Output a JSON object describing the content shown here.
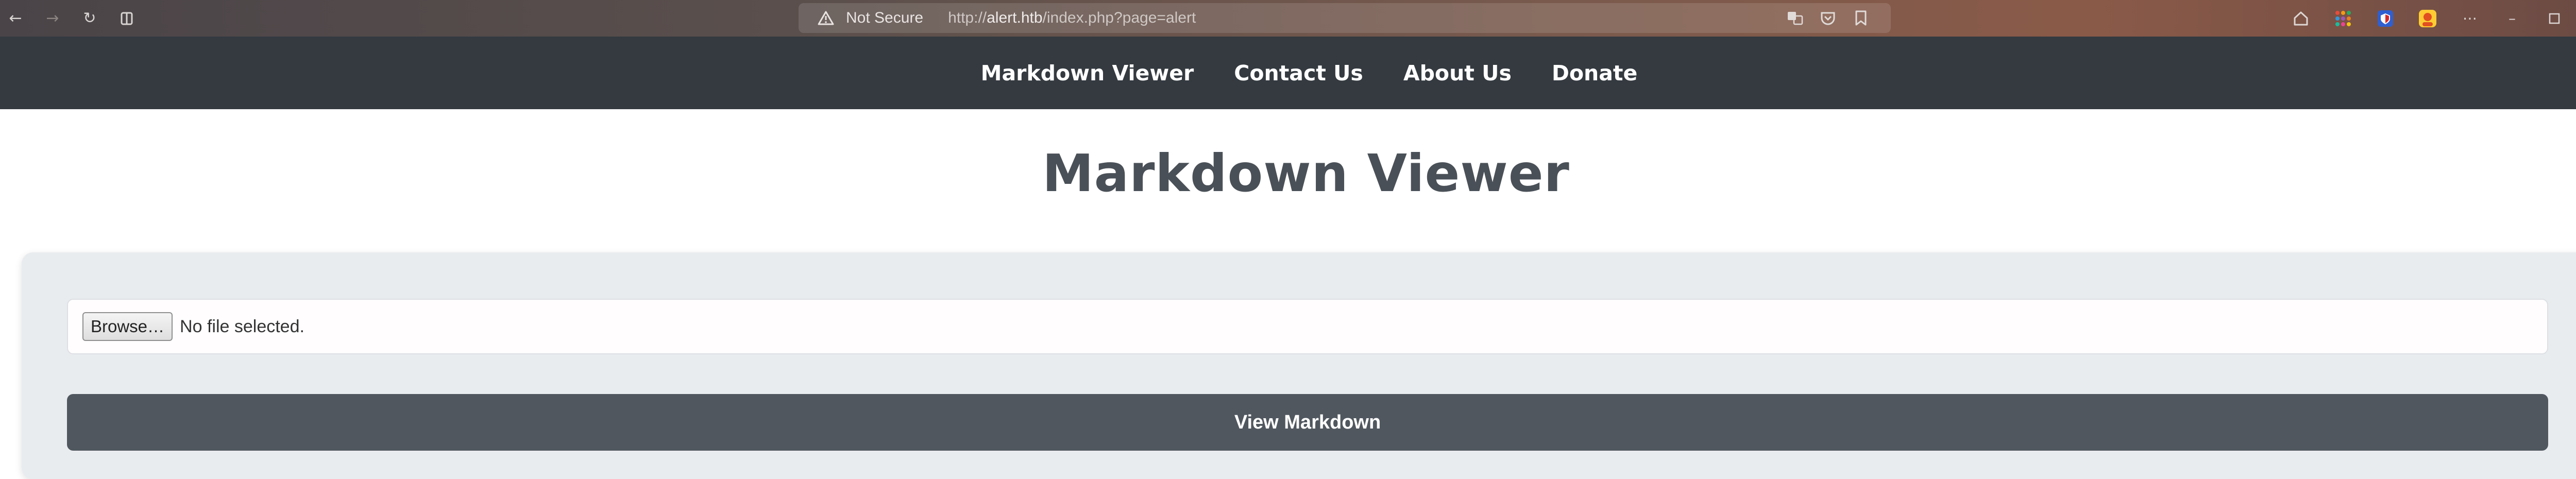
{
  "browser": {
    "not_secure_label": "Not Secure",
    "url_prefix": "http://",
    "url_host": "alert.htb",
    "url_path": "/index.php?page=alert",
    "icons": {
      "back": "back-arrow-icon",
      "forward": "forward-arrow-icon",
      "reload": "reload-icon",
      "reader": "reader-mode-icon",
      "warning": "warning-triangle-icon",
      "translate": "translate-icon",
      "pocket": "save-to-pocket-icon",
      "bookmark": "bookmark-icon",
      "home": "home-icon",
      "apps": "apps-grid-icon",
      "extension": "extension-shield-icon",
      "profile": "profile-icon",
      "menu": "menu-dots-icon",
      "minimize": "minimize-icon",
      "maximize": "maximize-icon",
      "close": "close-icon"
    }
  },
  "nav": {
    "items": [
      {
        "label": "Markdown Viewer"
      },
      {
        "label": "Contact Us"
      },
      {
        "label": "About Us"
      },
      {
        "label": "Donate"
      }
    ]
  },
  "main": {
    "title": "Markdown Viewer",
    "file_input": {
      "button_label": "Browse…",
      "status": "No file selected."
    },
    "submit_label": "View Markdown"
  },
  "colors": {
    "nav_bg": "#343a40",
    "panel_bg": "#e9ecef",
    "button_bg": "#50575f",
    "title": "#4a5057"
  }
}
